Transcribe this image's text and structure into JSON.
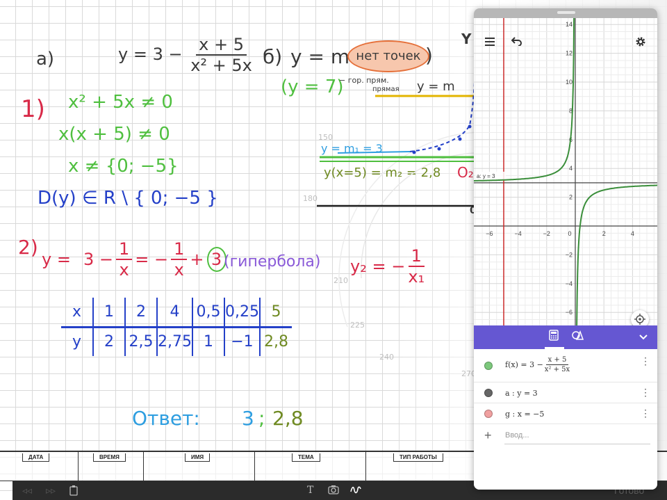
{
  "whiteboard": {
    "part_a": {
      "label": "а)",
      "func_prefix": "y = 3 −",
      "func_num": "x + 5",
      "func_den": "x² + 5x"
    },
    "part_b": {
      "label": "б)",
      "expr": "y = m",
      "note": "нет точек",
      "y7": "(y = 7)",
      "y7_note": "− гор. прям.",
      "y7_note2": "прямая",
      "ym": "y = m",
      "y_m1": "y = m₁ = 3",
      "y_m2": "y(x=5) = m₂ = 2,8",
      "o2": "O₂",
      "zero": "0",
      "y_axis_label": "Y"
    },
    "step1": {
      "number": "1)",
      "line1": "x² + 5x ≠ 0",
      "line2": "x(x + 5) ≠ 0",
      "line3": "x ≠ {0; −5}",
      "domain": "D(y) ∈ R \\ { 0; −5 }"
    },
    "step2": {
      "number": "2)",
      "y_part": "y =",
      "mid": "3 −",
      "frac1_num": "1",
      "frac1_den": "x",
      "eq": "= −",
      "frac2_num": "1",
      "frac2_den": "x",
      "plus": "+",
      "circled": "3",
      "note": "(гипербола)",
      "y2": "y₂ = −",
      "y2_num": "1",
      "y2_den": "x₁"
    },
    "table": {
      "x_row": [
        "x",
        "1",
        "2",
        "4",
        "0,5",
        "0,25",
        "5"
      ],
      "y_row": [
        "y",
        "2",
        "2,5",
        "2,75",
        "1",
        "−1",
        "2,8"
      ]
    },
    "answer": {
      "label": "Ответ:",
      "value1": "3",
      "sep": ";",
      "value2": "2,8"
    },
    "protractor_marks": [
      "150",
      "180",
      "210",
      "225",
      "240",
      "270"
    ]
  },
  "bottom_strip": {
    "labels": [
      "ДАТА",
      "ВРЕМЯ",
      "ИМЯ",
      "ТЕМА",
      "ТИП РАБОТЫ"
    ]
  },
  "toolbar": {
    "back": "◃◃",
    "forward": "▹▹",
    "done": "Готово"
  },
  "geogebra": {
    "axis_label_a": "a: y = 3",
    "x_ticks": [
      "−6",
      "−4",
      "−2",
      "0",
      "2",
      "4"
    ],
    "y_ticks": [
      "14",
      "12",
      "10",
      "8",
      "6",
      "4",
      "2",
      "−2",
      "−4",
      "−6"
    ],
    "colors": {
      "f": "#3a8e3a",
      "a": "#444444",
      "g": "#cc2a2a",
      "accent": "#6557d2"
    },
    "algebra": [
      {
        "name": "f(x) = 3 −",
        "num": "x + 5",
        "den": "x² + 5x",
        "dot_color": "#7cc87c"
      },
      {
        "name": "a : y = 3",
        "dot_color": "#666666"
      },
      {
        "name": "g : x = −5",
        "dot_color": "#f0a0a0"
      }
    ],
    "input_placeholder": "Ввод..."
  }
}
